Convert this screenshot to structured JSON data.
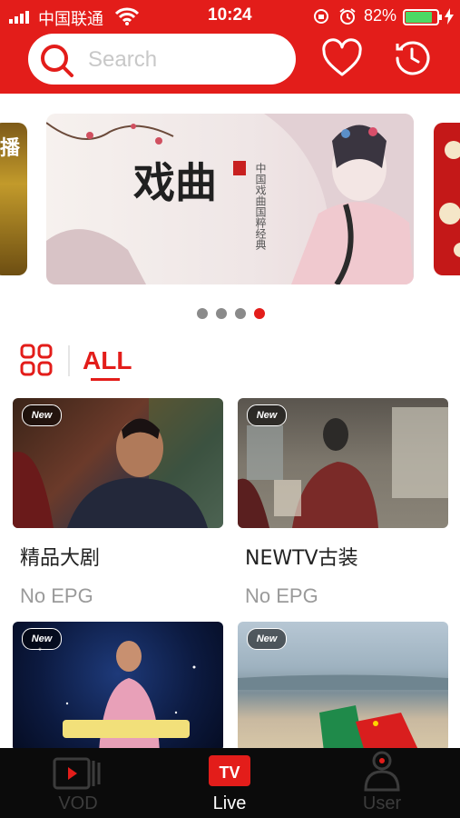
{
  "status_bar": {
    "carrier": "中国联通",
    "time": "10:24",
    "battery": "82%"
  },
  "header": {
    "search_placeholder": "Search"
  },
  "carousel": {
    "main_banner": {
      "art_title": "戏曲",
      "subtitle": "中国戏曲国粹经典"
    },
    "left_peek": "播",
    "dot_count": 4,
    "active_dot": 4
  },
  "category": {
    "title": "ALL"
  },
  "channels": [
    {
      "name": "精品大剧",
      "epg": "No EPG",
      "badge": "New"
    },
    {
      "name": "NEWTV古装",
      "epg": "No EPG",
      "badge": "New"
    },
    {
      "name": "",
      "epg": "",
      "badge": "New"
    },
    {
      "name": "",
      "epg": "",
      "badge": "New"
    }
  ],
  "tab_bar": {
    "tabs": [
      {
        "label": "VOD",
        "active": false
      },
      {
        "label": "Live",
        "active": true
      },
      {
        "label": "User",
        "active": false
      }
    ]
  },
  "colors": {
    "brand": "#e31d1a",
    "tab_bg": "#0b0b0b",
    "inactive_tab": "#3c3c3c"
  }
}
